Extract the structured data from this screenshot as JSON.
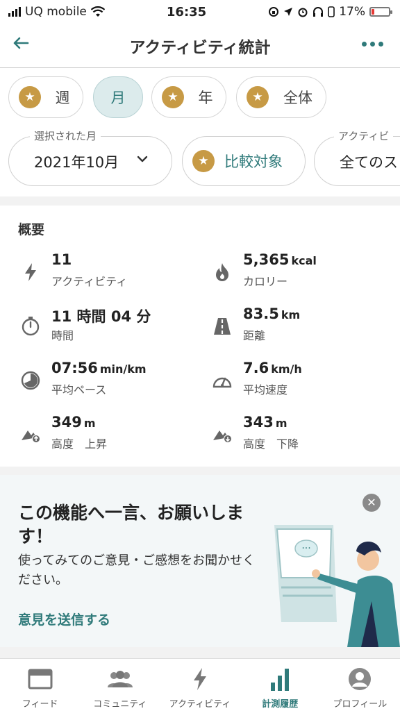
{
  "status_bar": {
    "carrier": "UQ mobile",
    "time": "16:35",
    "battery": "17%",
    "battery_level": 0.17
  },
  "header": {
    "title": "アクティビティ統計"
  },
  "period_tabs": [
    {
      "label": "週",
      "active": false
    },
    {
      "label": "月",
      "active": true
    },
    {
      "label": "年",
      "active": false
    },
    {
      "label": "全体",
      "active": false
    }
  ],
  "filters": {
    "month_label": "選択された月",
    "month_value": "2021年10月",
    "compare_label": "比較対象",
    "activity_label": "アクティビ",
    "activity_value": "全てのス"
  },
  "summary": {
    "title": "概要",
    "stats": [
      {
        "value": "11",
        "unit": "",
        "label": "アクティビティ",
        "icon": "lightning-icon"
      },
      {
        "value": "5,365",
        "unit": "kcal",
        "label": "カロリー",
        "icon": "flame-icon"
      },
      {
        "value": "11 時間 04 分",
        "unit": "",
        "label": "時間",
        "icon": "stopwatch-icon"
      },
      {
        "value": "83.5",
        "unit": "km",
        "label": "距離",
        "icon": "road-icon"
      },
      {
        "value": "07:56",
        "unit": "min/km",
        "label": "平均ペース",
        "icon": "pace-icon"
      },
      {
        "value": "7.6",
        "unit": "km/h",
        "label": "平均速度",
        "icon": "speedometer-icon"
      },
      {
        "value": "349",
        "unit": "m",
        "label": "高度　上昇",
        "icon": "elevation-up-icon"
      },
      {
        "value": "343",
        "unit": "m",
        "label": "高度　下降",
        "icon": "elevation-down-icon"
      }
    ]
  },
  "feedback": {
    "title": "この機能へ一言、お願いします！",
    "body": "使ってみてのご意見・ご感想をお聞かせください。",
    "link": "意見を送信する",
    "bubble": "···"
  },
  "tabs": [
    {
      "label": "フィード",
      "icon": "feed-icon",
      "active": false
    },
    {
      "label": "コミュニティ",
      "icon": "community-icon",
      "active": false
    },
    {
      "label": "アクティビティ",
      "icon": "lightning-icon",
      "active": false
    },
    {
      "label": "計測履歴",
      "icon": "bar-chart-icon",
      "active": true
    },
    {
      "label": "プロフィール",
      "icon": "profile-icon",
      "active": false
    }
  ],
  "colors": {
    "accent": "#2f7a7a",
    "star": "#c79a45",
    "battery_low": "#e53935"
  }
}
